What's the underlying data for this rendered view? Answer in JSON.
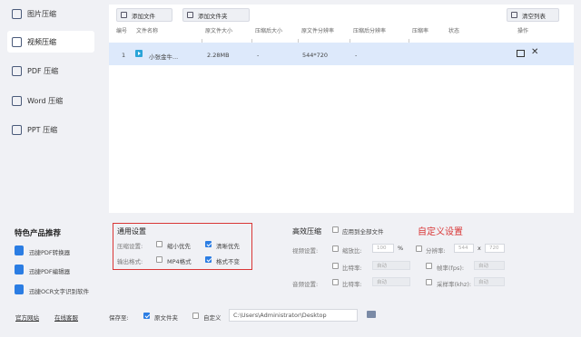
{
  "sidebar": {
    "items": [
      {
        "label": "图片压缩",
        "active": false
      },
      {
        "label": "视频压缩",
        "active": true
      },
      {
        "label": "PDF 压缩",
        "active": false
      },
      {
        "label": "Word 压缩",
        "active": false
      },
      {
        "label": "PPT 压缩",
        "active": false
      }
    ],
    "products_title": "特色产品推荐",
    "products": [
      "迅捷PDF转换器",
      "迅捷PDF编辑器",
      "迅捷OCR文字识别软件"
    ],
    "footer_links": [
      "官方网站",
      "在线客服"
    ]
  },
  "toolbar": {
    "add_file": "添加文件",
    "add_folder": "添加文件夹",
    "clear_list": "清空列表"
  },
  "table": {
    "headers": [
      "编号",
      "文件名称",
      "原文件大小",
      "压缩后大小",
      "原文件分辨率",
      "压缩后分辨率",
      "压缩率",
      "状态",
      "操作"
    ],
    "rows": [
      {
        "index": "1",
        "name": "小张金牛...",
        "size": "2.28MB",
        "compressed_size": "-",
        "resolution": "544*720",
        "compressed_resolution": "-",
        "ratio": "",
        "status": ""
      }
    ]
  },
  "general": {
    "title": "通用设置",
    "compress_label": "压缩设置:",
    "opt_small": "缩小优先",
    "opt_clear": "清晰优先",
    "output_label": "输出格式:",
    "opt_mp4": "MP4格式",
    "opt_keep": "格式不变",
    "opt_small_checked": false,
    "opt_clear_checked": true,
    "opt_mp4_checked": false,
    "opt_keep_checked": true
  },
  "advanced": {
    "title": "高效压缩",
    "apply_all": "应用到全部文件",
    "custom": "自定义设置",
    "video_label": "视频设置:",
    "scale": "缩放比:",
    "scale_value": "100",
    "percent": "%",
    "resolution_label": "分辨率:",
    "res_w": "544",
    "res_x": "x",
    "res_h": "720",
    "bitrate": "比特率:",
    "bitrate_value": "自动",
    "fps": "帧率(fps):",
    "fps_value": "自动",
    "audio_label": "音频设置:",
    "audio_bitrate": "比特率:",
    "audio_bitrate_value": "自动",
    "sample_rate": "采样率(khz):",
    "sample_rate_value": "自动"
  },
  "save": {
    "label": "保存至:",
    "opt_original": "原文件夹",
    "opt_custom": "自定义",
    "path": "C:\\Users\\Administrator\\Desktop",
    "opt_original_checked": true,
    "opt_custom_checked": false
  },
  "colors": {
    "accent": "#2b7de3",
    "highlight_red": "#d93636",
    "row_selected": "#dde9fb"
  }
}
